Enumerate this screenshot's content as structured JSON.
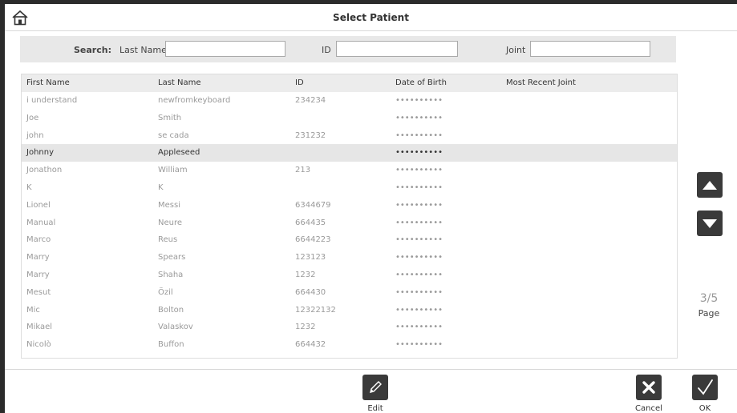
{
  "window": {
    "title": "Select Patient"
  },
  "search": {
    "label": "Search:",
    "last_name_label": "Last Name",
    "last_name_value": "",
    "id_label": "ID",
    "id_value": "",
    "joint_label": "Joint",
    "joint_value": ""
  },
  "table": {
    "columns": [
      "First Name",
      "Last Name",
      "ID",
      "Date of Birth",
      "Most Recent Joint"
    ],
    "rows": [
      {
        "first": "i understand",
        "last": "newfromkeyboard",
        "id": "234234",
        "dob": "••••••••••",
        "joint": "",
        "selected": false
      },
      {
        "first": "Joe",
        "last": "Smith",
        "id": "",
        "dob": "••••••••••",
        "joint": "",
        "selected": false
      },
      {
        "first": "john",
        "last": "se cada",
        "id": "231232",
        "dob": "••••••••••",
        "joint": "",
        "selected": false
      },
      {
        "first": "Johnny",
        "last": "Appleseed",
        "id": "",
        "dob": "••••••••••",
        "joint": "",
        "selected": true
      },
      {
        "first": "Jonathon",
        "last": "William",
        "id": "213",
        "dob": "••••••••••",
        "joint": "",
        "selected": false
      },
      {
        "first": "K",
        "last": "K",
        "id": "",
        "dob": "••••••••••",
        "joint": "",
        "selected": false
      },
      {
        "first": "Lionel",
        "last": "Messi",
        "id": "6344679",
        "dob": "••••••••••",
        "joint": "",
        "selected": false
      },
      {
        "first": "Manual",
        "last": "Neure",
        "id": "664435",
        "dob": "••••••••••",
        "joint": "",
        "selected": false
      },
      {
        "first": "Marco",
        "last": "Reus",
        "id": "6644223",
        "dob": "••••••••••",
        "joint": "",
        "selected": false
      },
      {
        "first": "Marry",
        "last": "Spears",
        "id": "123123",
        "dob": "••••••••••",
        "joint": "",
        "selected": false
      },
      {
        "first": "Marry",
        "last": "Shaha",
        "id": "1232",
        "dob": "••••••••••",
        "joint": "",
        "selected": false
      },
      {
        "first": "Mesut",
        "last": "Özil",
        "id": "664430",
        "dob": "••••••••••",
        "joint": "",
        "selected": false
      },
      {
        "first": "Mic",
        "last": "Bolton",
        "id": "12322132",
        "dob": "••••••••••",
        "joint": "",
        "selected": false
      },
      {
        "first": "Mikael",
        "last": "Valaskov",
        "id": "1232",
        "dob": "••••••••••",
        "joint": "",
        "selected": false
      },
      {
        "first": "Nicolò",
        "last": "Buffon",
        "id": "664432",
        "dob": "••••••••••",
        "joint": "",
        "selected": false
      }
    ]
  },
  "pagination": {
    "current": "3/5",
    "label": "Page"
  },
  "footer": {
    "edit_label": "Edit",
    "cancel_label": "Cancel",
    "ok_label": "OK"
  },
  "icons": {
    "home": "home-icon",
    "up": "arrow-up-icon",
    "down": "arrow-down-icon",
    "edit": "pencil-icon",
    "cancel": "x-icon",
    "ok": "check-icon"
  },
  "colors": {
    "button_bg": "#3a3a3a",
    "selected_row": "#e6e6e6",
    "search_bg": "#e8e8e8"
  }
}
